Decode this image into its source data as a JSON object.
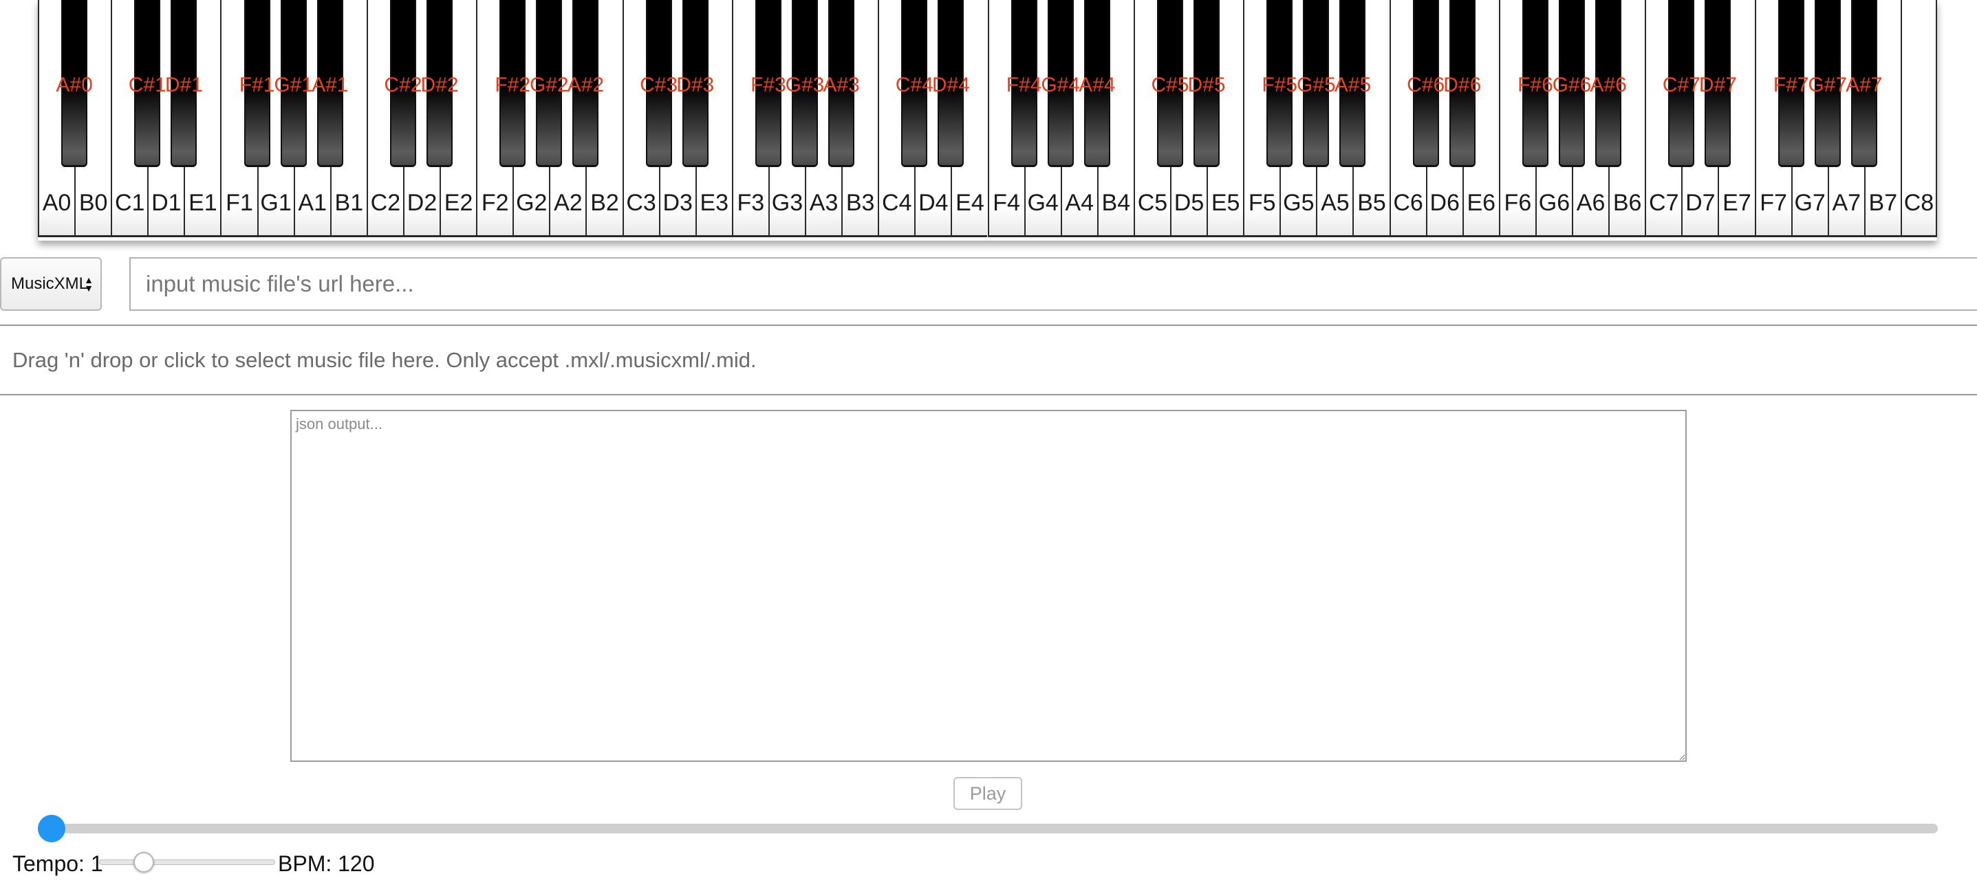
{
  "piano": {
    "white_keys": [
      "A0",
      "B0",
      "C1",
      "D1",
      "E1",
      "F1",
      "G1",
      "A1",
      "B1",
      "C2",
      "D2",
      "E2",
      "F2",
      "G2",
      "A2",
      "B2",
      "C3",
      "D3",
      "E3",
      "F3",
      "G3",
      "A3",
      "B3",
      "C4",
      "D4",
      "E4",
      "F4",
      "G4",
      "A4",
      "B4",
      "C5",
      "D5",
      "E5",
      "F5",
      "G5",
      "A5",
      "B5",
      "C6",
      "D6",
      "E6",
      "F6",
      "G6",
      "A6",
      "B6",
      "C7",
      "D7",
      "E7",
      "F7",
      "G7",
      "A7",
      "B7",
      "C8"
    ],
    "black_keys": [
      "A#0",
      "C#1",
      "D#1",
      "F#1",
      "G#1",
      "A#1",
      "C#2",
      "D#2",
      "F#2",
      "G#2",
      "A#2",
      "C#3",
      "D#3",
      "F#3",
      "G#3",
      "A#3",
      "C#4",
      "D#4",
      "F#4",
      "G#4",
      "A#4",
      "C#5",
      "D#5",
      "F#5",
      "G#5",
      "A#5",
      "C#6",
      "D#6",
      "F#6",
      "G#6",
      "A#6",
      "C#7",
      "D#7",
      "F#7",
      "G#7",
      "A#7"
    ],
    "colors": {
      "black_label": "#e8401c",
      "white_label": "#1a1a1a"
    }
  },
  "format_select": {
    "selected": "MusicXML"
  },
  "url_input": {
    "value": "",
    "placeholder": "input music file's url here..."
  },
  "dropzone": {
    "text": "Drag 'n' drop or click to select music file here. Only accept .mxl/.musicxml/.mid."
  },
  "json_output": {
    "value": "",
    "placeholder": "json output..."
  },
  "play_button": {
    "label": "Play"
  },
  "progress": {
    "value": 0,
    "color": "#2196f3"
  },
  "tempo": {
    "label": "Tempo: 1",
    "slider_fraction": 0.25
  },
  "bpm": {
    "label": "BPM: 120"
  }
}
